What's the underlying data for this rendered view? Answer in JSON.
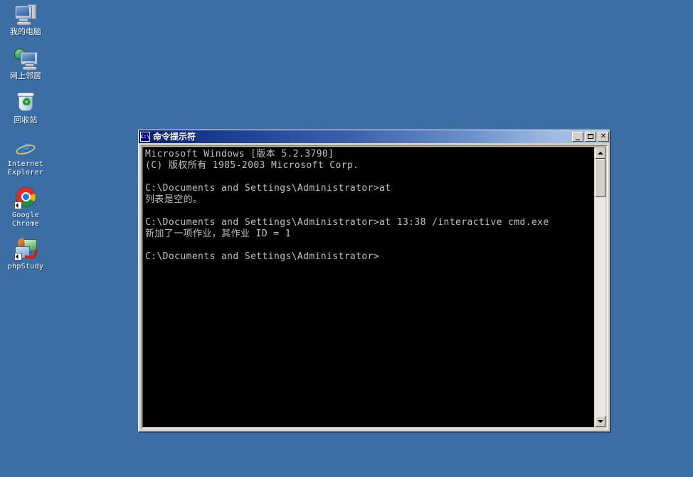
{
  "desktop": {
    "background_color": "#3a6ea5",
    "icons": [
      {
        "label": "我的电脑",
        "icon": "my-computer-icon",
        "script": "cjk",
        "shortcut": false
      },
      {
        "label": "网上邻居",
        "icon": "network-places-icon",
        "script": "cjk",
        "shortcut": false
      },
      {
        "label": "回收站",
        "icon": "recycle-bin-icon",
        "script": "cjk",
        "shortcut": false
      },
      {
        "label": "Internet Explorer",
        "icon": "internet-explorer-icon",
        "script": "latin",
        "shortcut": false
      },
      {
        "label": "Google Chrome",
        "icon": "google-chrome-icon",
        "script": "latin",
        "shortcut": true
      },
      {
        "label": "phpStudy",
        "icon": "phpstudy-icon",
        "script": "latin",
        "shortcut": true
      }
    ]
  },
  "cmd_window": {
    "title": "命令提示符",
    "title_icon": "console-window-icon",
    "titlebar_gradient_from": "#0a246a",
    "titlebar_gradient_to": "#adc6e8",
    "controls": {
      "minimize": {
        "name": "minimize-button",
        "glyph": "_"
      },
      "maximize": {
        "name": "maximize-button",
        "glyph": ""
      },
      "close": {
        "name": "close-button",
        "glyph": "✕"
      }
    },
    "console": {
      "background_color": "#000000",
      "text_color": "#c0c0c0",
      "lines": [
        "Microsoft Windows [版本 5.2.3790]",
        "(C) 版权所有 1985-2003 Microsoft Corp.",
        "",
        "C:\\Documents and Settings\\Administrator>at",
        "列表是空的。",
        "",
        "C:\\Documents and Settings\\Administrator>at 13:38 /interactive cmd.exe",
        "新加了一项作业，其作业 ID = 1",
        "",
        "C:\\Documents and Settings\\Administrator>"
      ]
    },
    "scrollbar": {
      "up_button": "scroll-up-button",
      "down_button": "scroll-down-button",
      "thumb": "scrollbar-thumb"
    }
  }
}
